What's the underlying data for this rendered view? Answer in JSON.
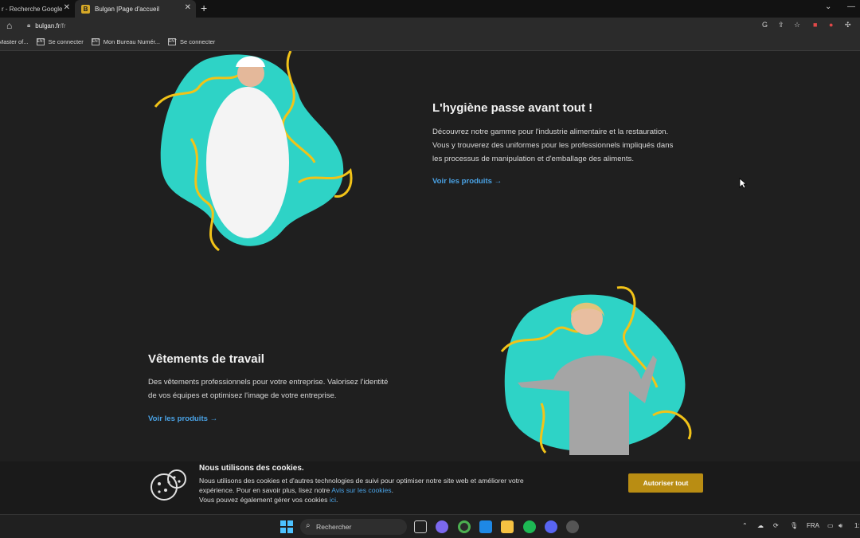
{
  "browser": {
    "tabs": [
      {
        "label": "r - Recherche Google"
      },
      {
        "label": "Bulgan |Page d'accueil",
        "favicon": "B"
      }
    ],
    "new_tab": "+",
    "address": {
      "host": "bulgan.fr",
      "path": "/fr"
    },
    "bookmarks": [
      {
        "label": "Master of..."
      },
      {
        "label": "Se connecter"
      },
      {
        "label": "Mon Bureau Numér..."
      },
      {
        "label": "Se connecter"
      }
    ]
  },
  "sections": {
    "hygiene": {
      "title": "L'hygiène passe avant tout !",
      "text_lines": [
        "Découvrez notre gamme pour l'industrie alimentaire et la restauration.",
        "Vous y trouverez des uniformes pour les professionnels impliqués dans",
        "les processus de manipulation et d'emballage des aliments."
      ],
      "cta": "Voir les produits  →"
    },
    "workwear": {
      "title": "Vêtements de travail",
      "text_lines": [
        "Des vêtements professionnels pour votre entreprise. Valorisez l'identité",
        "de vos équipes et optimisez l'image de votre entreprise."
      ],
      "cta": "Voir les produits  →"
    }
  },
  "cookie_banner": {
    "title": "Nous utilisons des cookies.",
    "line1": "Nous utilisons des cookies et d'autres technologies de suivi pour optimiser notre site web et améliorer votre",
    "line2_pre": "expérience. Pour en savoir plus, lisez notre ",
    "line2_link": "Avis sur les cookies",
    "line2_post": ".",
    "line3_pre": "Vous pouvez également gérer vos cookies ",
    "line3_link": "ici",
    "line3_post": ".",
    "accept_label": "Autoriser tout"
  },
  "taskbar": {
    "search_placeholder": "Rechercher",
    "language": "FRA",
    "clock_partial": "1:"
  },
  "colors": {
    "accent_blue": "#4aa3e6",
    "blob_teal": "#2ed3c6",
    "squiggle_yellow": "#f2c318",
    "accept_gold": "#b98d13"
  }
}
